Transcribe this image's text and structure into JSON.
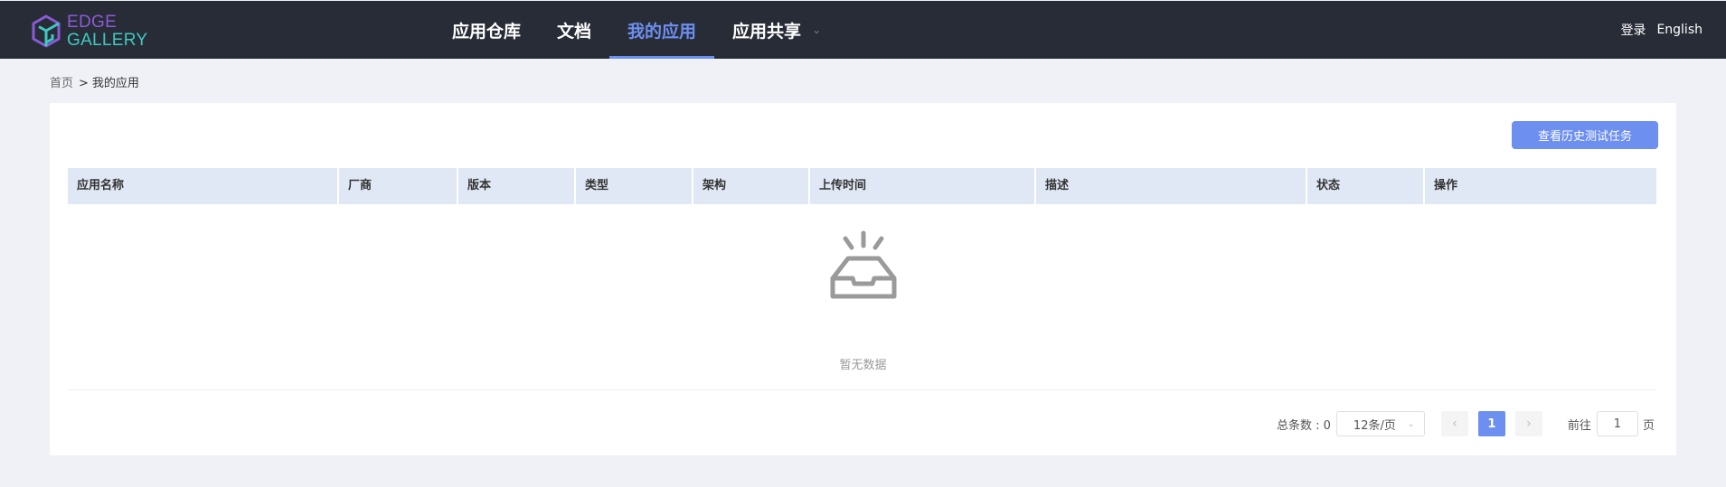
{
  "header": {
    "logo_line1": "EDGE",
    "logo_line2": "GALLERY",
    "nav": [
      {
        "label": "应用仓库"
      },
      {
        "label": "文档"
      },
      {
        "label": "我的应用"
      },
      {
        "label": "应用共享"
      }
    ],
    "login": "登录",
    "language": "English"
  },
  "breadcrumb": {
    "home": "首页",
    "separator": ">",
    "current": "我的应用"
  },
  "toolbar": {
    "history_button": "查看历史测试任务"
  },
  "table": {
    "columns": [
      "应用名称",
      "厂商",
      "版本",
      "类型",
      "架构",
      "上传时间",
      "描述",
      "状态",
      "操作"
    ],
    "rows": [],
    "empty_text": "暂无数据"
  },
  "pagination": {
    "total_label": "总条数 : 0",
    "page_size": "12条/页",
    "current_page": "1",
    "goto_prefix": "前往",
    "goto_value": "1",
    "goto_suffix": "页"
  },
  "colors": {
    "header_bg": "#282c37",
    "accent": "#6d8ff0",
    "table_header_bg": "#e0e7f5"
  }
}
